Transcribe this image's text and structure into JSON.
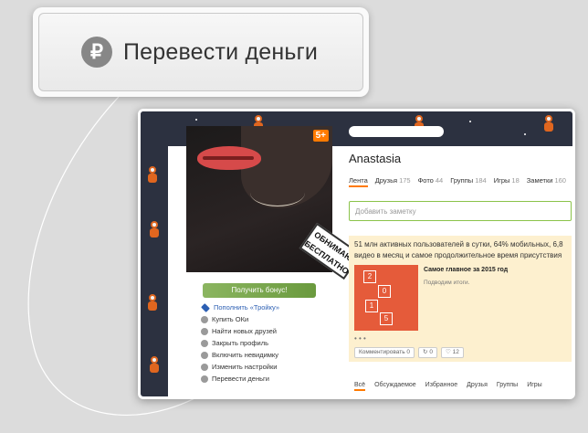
{
  "callout": {
    "icon": "ruble-icon",
    "icon_glyph": "₽",
    "label": "Перевести деньги"
  },
  "profile": {
    "badge": "5+",
    "sticker": "ОБНИМАЮ БЕСПЛАТНО",
    "bonus_button": "Получить бонус!",
    "menu": [
      {
        "icon": "star-icon",
        "label": "Пополнить «Тройку»"
      },
      {
        "icon": "coin-icon",
        "label": "Купить ОКи"
      },
      {
        "icon": "user-icon",
        "label": "Найти новых друзей"
      },
      {
        "icon": "lock-icon",
        "label": "Закрыть профиль"
      },
      {
        "icon": "eye-icon",
        "label": "Включить невидимку"
      },
      {
        "icon": "gear-icon",
        "label": "Изменить настройки"
      },
      {
        "icon": "ruble-icon",
        "label": "Перевести деньги"
      }
    ],
    "name": "Anastasia",
    "tabs": [
      {
        "label": "Лента",
        "count": ""
      },
      {
        "label": "Друзья",
        "count": "175"
      },
      {
        "label": "Фото",
        "count": "44"
      },
      {
        "label": "Группы",
        "count": "184"
      },
      {
        "label": "Игры",
        "count": "18"
      },
      {
        "label": "Заметки",
        "count": "160"
      }
    ],
    "note_placeholder": "Добавить заметку"
  },
  "feed": {
    "text_line1": "51 млн активных пользователей в сутки, 64% мобильных, 6,8",
    "text_line2": "видео в месяц и самое продолжительное время присутствия",
    "image_digits": [
      "2",
      "0",
      "1",
      "5"
    ],
    "title": "Самое главное за 2015 год",
    "subtitle": "Подводим итоги.",
    "dots": "• • •",
    "actions": {
      "comment": "Комментировать",
      "comment_count": "0",
      "share_count": "0",
      "like_count": "12"
    }
  },
  "bottom_tabs": [
    "Всё",
    "Обсуждаемое",
    "Избранное",
    "Друзья",
    "Группы",
    "Игры"
  ]
}
